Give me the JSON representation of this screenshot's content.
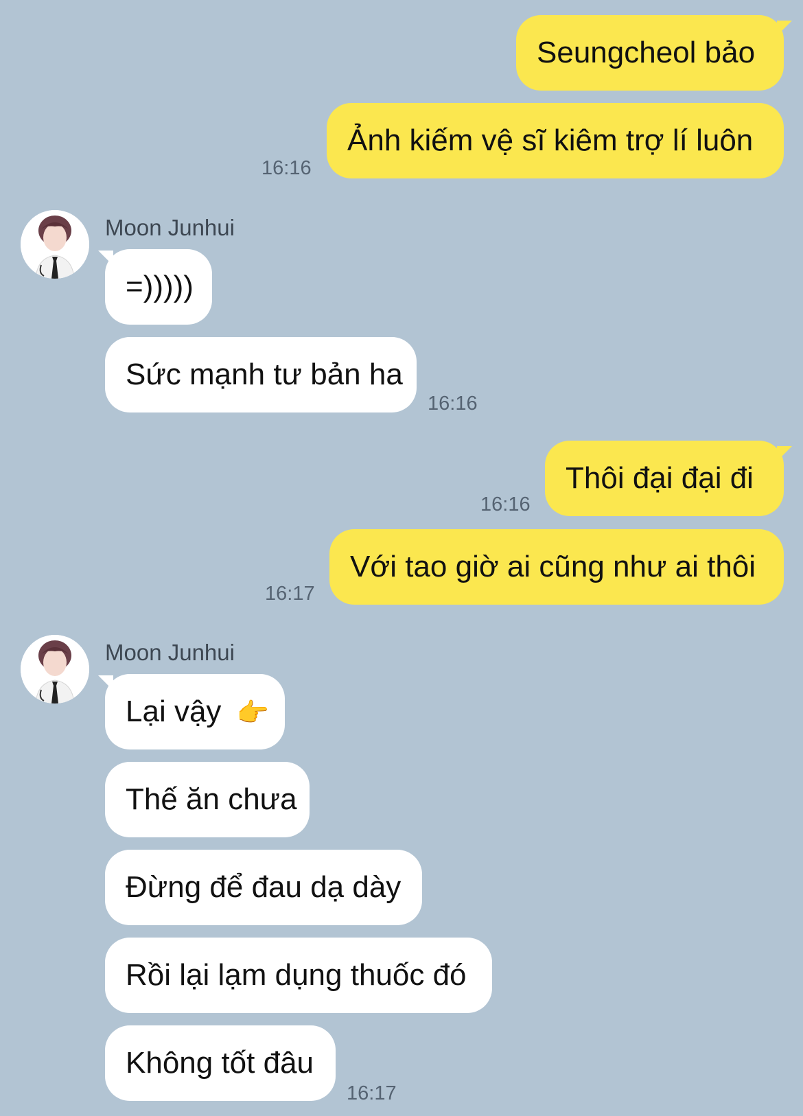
{
  "messages": {
    "out1": {
      "text": "Seungcheol bảo"
    },
    "out2": {
      "text": "Ảnh kiếm vệ sĩ kiêm trợ lí luôn",
      "time": "16:16"
    },
    "group1": {
      "sender": "Moon Junhui",
      "m1": "=)))))",
      "m2": "Sức mạnh tư bản ha",
      "time": "16:16"
    },
    "out3": {
      "text": "Thôi đại đại đi",
      "time": "16:16"
    },
    "out4": {
      "text": "Với tao giờ ai cũng như ai thôi",
      "time": "16:17"
    },
    "group2": {
      "sender": "Moon Junhui",
      "m1": "Lại vậy",
      "m1_emoji": "👉",
      "m2": "Thế ăn chưa",
      "m3": "Đừng để đau dạ dày",
      "m4": "Rồi lại lạm dụng thuốc đó",
      "m5": "Không tốt đâu",
      "time": "16:17"
    }
  },
  "icons": {
    "avatar": "avatar-icon",
    "pointing_hand": "pointing-hand-icon"
  },
  "colors": {
    "background": "#b2c4d3",
    "outgoing_bubble": "#fbe74f",
    "incoming_bubble": "#ffffff"
  }
}
